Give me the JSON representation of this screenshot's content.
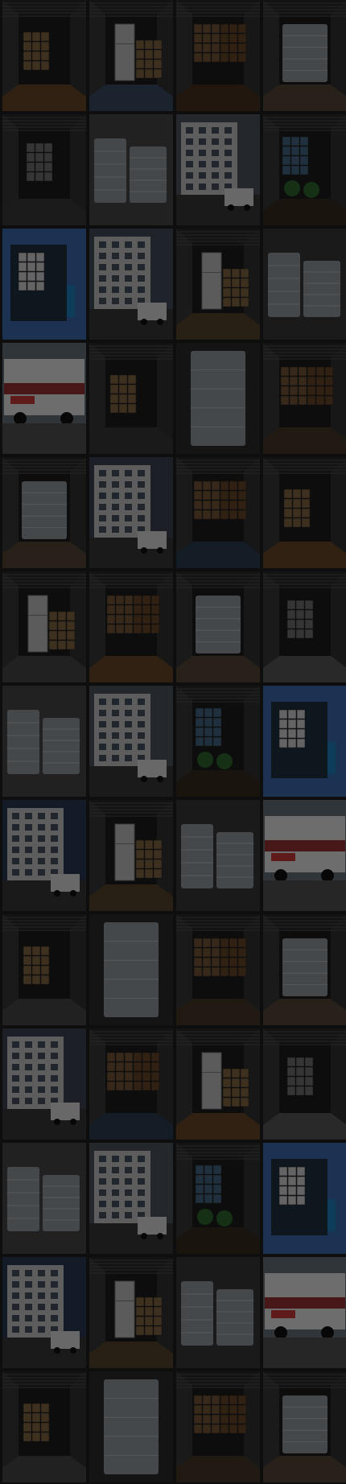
{
  "gallery": {
    "columns": 4,
    "rows": 13,
    "tiles": [
      {
        "kind": "truck-interior",
        "palette": "#6b4a2a"
      },
      {
        "kind": "truck-fridge",
        "palette": "#3a4f66"
      },
      {
        "kind": "truck-boxes",
        "palette": "#4a3420"
      },
      {
        "kind": "truck-wrapped",
        "palette": "#5c5c5c"
      },
      {
        "kind": "truck-open",
        "palette": "#3d3d3d"
      },
      {
        "kind": "wrapped-furniture",
        "palette": "#4b4b4b"
      },
      {
        "kind": "building-street",
        "palette": "#505862"
      },
      {
        "kind": "truck-plants",
        "palette": "#2f3c4a"
      },
      {
        "kind": "truck-blue",
        "palette": "#2d5a9c"
      },
      {
        "kind": "street-van",
        "palette": "#44505e"
      },
      {
        "kind": "truck-fridge",
        "palette": "#5a4630"
      },
      {
        "kind": "wrapped-furniture",
        "palette": "#3b3b3b"
      },
      {
        "kind": "van-branded",
        "palette": "#a13535"
      },
      {
        "kind": "truck-interior",
        "palette": "#3b3b3b"
      },
      {
        "kind": "wrapped-fridge",
        "palette": "#5a5a5a"
      },
      {
        "kind": "truck-boxes",
        "palette": "#4a3a2a"
      },
      {
        "kind": "truck-wrapped",
        "palette": "#4e3d30"
      },
      {
        "kind": "building-street",
        "palette": "#3e4856"
      },
      {
        "kind": "truck-boxes",
        "palette": "#2e3f55"
      },
      {
        "kind": "truck-interior",
        "palette": "#6b4a2a"
      },
      {
        "kind": "truck-fridge",
        "palette": "#4b4b4b"
      },
      {
        "kind": "truck-boxes",
        "palette": "#6b4a2a"
      },
      {
        "kind": "truck-wrapped",
        "palette": "#4a3420"
      },
      {
        "kind": "truck-open",
        "palette": "#5c5c5c"
      },
      {
        "kind": "wrapped-furniture",
        "palette": "#4b4b4b"
      },
      {
        "kind": "building-street",
        "palette": "#505862"
      },
      {
        "kind": "truck-plants",
        "palette": "#2f3c4a"
      },
      {
        "kind": "truck-blue",
        "palette": "#2d5a9c"
      },
      {
        "kind": "street-van",
        "palette": "#2a3a5a"
      },
      {
        "kind": "truck-fridge",
        "palette": "#5a4630"
      },
      {
        "kind": "wrapped-furniture",
        "palette": "#3b3b3b"
      },
      {
        "kind": "van-branded",
        "palette": "#a13535"
      },
      {
        "kind": "truck-interior",
        "palette": "#4b4b4b"
      },
      {
        "kind": "wrapped-fridge",
        "palette": "#5a5a5a"
      },
      {
        "kind": "truck-boxes",
        "palette": "#4a3a2a"
      },
      {
        "kind": "truck-wrapped",
        "palette": "#4e3d30"
      },
      {
        "kind": "building-street",
        "palette": "#3e4856"
      },
      {
        "kind": "truck-boxes",
        "palette": "#2e3f55"
      },
      {
        "kind": "truck-fridge",
        "palette": "#6b4a2a"
      },
      {
        "kind": "truck-open",
        "palette": "#5c5c5c"
      },
      {
        "kind": "wrapped-furniture",
        "palette": "#4b4b4b"
      },
      {
        "kind": "building-street",
        "palette": "#505862"
      },
      {
        "kind": "truck-plants",
        "palette": "#2f3c4a"
      },
      {
        "kind": "truck-blue",
        "palette": "#2d5a9c"
      },
      {
        "kind": "street-van",
        "palette": "#2a3a5a"
      },
      {
        "kind": "truck-fridge",
        "palette": "#5a4630"
      },
      {
        "kind": "wrapped-furniture",
        "palette": "#3b3b3b"
      },
      {
        "kind": "van-branded",
        "palette": "#a13535"
      },
      {
        "kind": "truck-interior",
        "palette": "#4b4b4b"
      },
      {
        "kind": "wrapped-fridge",
        "palette": "#5a5a5a"
      },
      {
        "kind": "truck-boxes",
        "palette": "#4a3a2a"
      },
      {
        "kind": "truck-wrapped",
        "palette": "#4e3d30"
      }
    ]
  }
}
